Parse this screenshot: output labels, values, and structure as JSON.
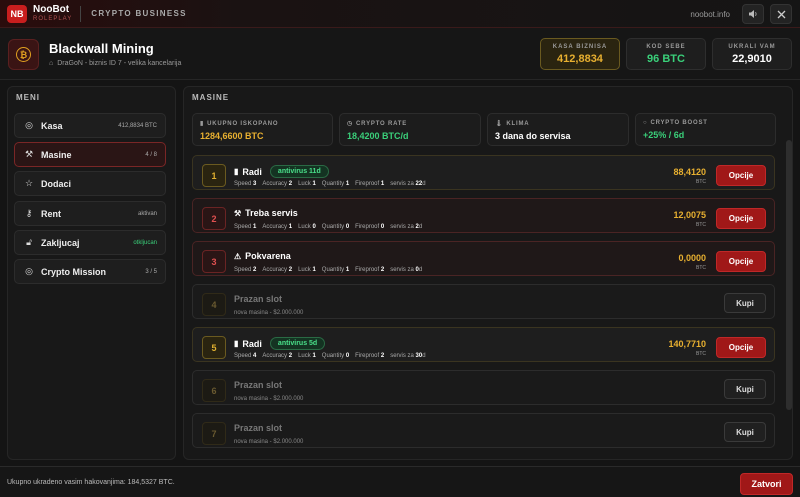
{
  "topbar": {
    "logo": "NB",
    "brand_name": "NooBot",
    "brand_sub": "ROLEPLAY",
    "section": "CRYPTO BUSINESS",
    "url": "noobot.info",
    "sound_icon": "speaker-icon",
    "close_icon": "close-icon"
  },
  "header": {
    "icon": "bitcoin-icon",
    "title": "Blackwall Mining",
    "subtitle": "DraGoN - biznis ID 7 - velika kancelarija",
    "stats": [
      {
        "label": "KASA BIZNISA",
        "value": "412,8834"
      },
      {
        "label": "KOD SEBE",
        "value": "96 BTC"
      },
      {
        "label": "UKRALI VAM",
        "value": "22,9010"
      }
    ]
  },
  "menu": {
    "heading": "MENI",
    "items": [
      {
        "label": "Kasa",
        "right": "412,8834 BTC",
        "icon": "coin-icon"
      },
      {
        "label": "Masine",
        "right": "4 / 8",
        "icon": "wrench-icon"
      },
      {
        "label": "Dodaci",
        "right": "",
        "icon": "star-icon"
      },
      {
        "label": "Rent",
        "right": "aktivan",
        "icon": "key-icon"
      },
      {
        "label": "Zakljucaj",
        "right": "otkljucan",
        "icon": "lock-icon"
      },
      {
        "label": "Crypto Mission",
        "right": "3 / 5",
        "icon": "target-icon"
      }
    ]
  },
  "machines": {
    "heading": "MASINE",
    "info": [
      {
        "label": "UKUPNO ISKOPANO",
        "value": "1284,6600 BTC",
        "color": "#e8b030",
        "icon": "chart-icon"
      },
      {
        "label": "CRYPTO RATE",
        "value": "18,4200 BTC/d",
        "color": "#3ad07a",
        "icon": "clock-icon"
      },
      {
        "label": "KLIMA",
        "value": "3 dana do servisa",
        "color": "#ffffff",
        "icon": "thermometer-icon"
      },
      {
        "label": "CRYPTO BOOST",
        "value": "+25% / 6d",
        "color": "#3ad07a",
        "icon": "bulb-icon"
      }
    ],
    "slots": [
      {
        "num": "1",
        "status": "Radi",
        "badge": "antivirus 11d",
        "amount": "88,4120",
        "currency": "BTC",
        "action": "Opcije",
        "stats": [
          {
            "k": "Speed",
            "v": "3"
          },
          {
            "k": "Accuracy",
            "v": "2"
          },
          {
            "k": "Luck",
            "v": "1"
          },
          {
            "k": "Quantity",
            "v": "1"
          },
          {
            "k": "Fireproof",
            "v": "1"
          },
          {
            "k": "servis za",
            "v": "22",
            "suffix": "d"
          }
        ]
      },
      {
        "num": "2",
        "status": "Treba servis",
        "badge": "",
        "amount": "12,0075",
        "currency": "BTC",
        "action": "Opcije",
        "stats": [
          {
            "k": "Speed",
            "v": "1"
          },
          {
            "k": "Accuracy",
            "v": "1"
          },
          {
            "k": "Luck",
            "v": "0"
          },
          {
            "k": "Quantity",
            "v": "0"
          },
          {
            "k": "Fireproof",
            "v": "0"
          },
          {
            "k": "servis za",
            "v": "2",
            "suffix": "d"
          }
        ]
      },
      {
        "num": "3",
        "status": "Pokvarena",
        "badge": "",
        "amount": "0,0000",
        "currency": "BTC",
        "action": "Opcije",
        "stats": [
          {
            "k": "Speed",
            "v": "2"
          },
          {
            "k": "Accuracy",
            "v": "2"
          },
          {
            "k": "Luck",
            "v": "1"
          },
          {
            "k": "Quantity",
            "v": "1"
          },
          {
            "k": "Fireproof",
            "v": "2"
          },
          {
            "k": "servis za",
            "v": "0",
            "suffix": "d"
          }
        ]
      },
      {
        "num": "4",
        "status": "Prazan slot",
        "sub": "nova masina - $2.000.000",
        "action": "Kupi"
      },
      {
        "num": "5",
        "status": "Radi",
        "badge": "antivirus 5d",
        "amount": "140,7710",
        "currency": "BTC",
        "action": "Opcije",
        "stats": [
          {
            "k": "Speed",
            "v": "4"
          },
          {
            "k": "Accuracy",
            "v": "2"
          },
          {
            "k": "Luck",
            "v": "1"
          },
          {
            "k": "Quantity",
            "v": "0"
          },
          {
            "k": "Fireproof",
            "v": "2"
          },
          {
            "k": "servis za",
            "v": "30",
            "suffix": "d"
          }
        ]
      },
      {
        "num": "6",
        "status": "Prazan slot",
        "sub": "nova masina - $2.000.000",
        "action": "Kupi"
      },
      {
        "num": "7",
        "status": "Prazan slot",
        "sub": "nova masina - $2.000.000",
        "action": "Kupi"
      }
    ]
  },
  "footer": {
    "text": "Ukupno ukradeno vasim hakovanjima: 184,5327 BTC.",
    "close_label": "Zatvori"
  }
}
